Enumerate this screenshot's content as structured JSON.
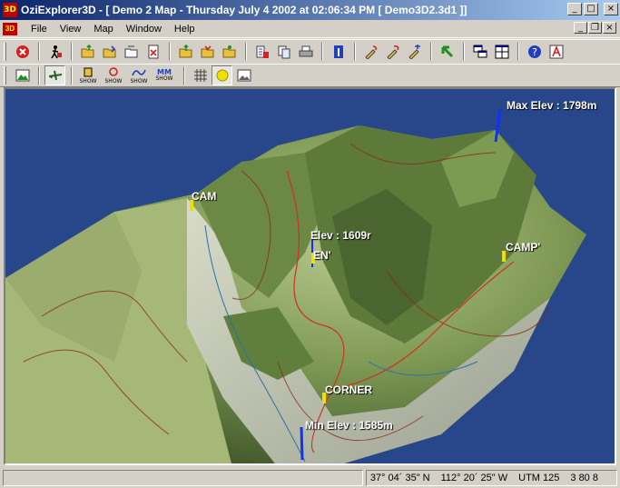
{
  "window": {
    "title": "OziExplorer3D - [ Demo 2 Map - Thursday July 4 2002  at  02:06:34 PM  [ Demo3D2.3d1 ]]",
    "app_icon_text": "3D"
  },
  "menu": {
    "items": [
      "File",
      "View",
      "Map",
      "Window",
      "Help"
    ]
  },
  "toolbar2": {
    "show_label": "SHOW",
    "mm_label": "MM"
  },
  "map": {
    "background_color": "#2a4a8a",
    "labels": {
      "max_elev": "Max Elev :  1798m",
      "min_elev": "Min Elev :  1585m",
      "elev": "Elev : 1609r",
      "cam": "CAM",
      "en": "EN'",
      "camp": "CAMP'",
      "corner": "CORNER"
    }
  },
  "status": {
    "main_text": "",
    "latitude": "37° 04´ 35\" N",
    "longitude": "112° 20´ 25\" W",
    "utm": "UTM  125",
    "easting": "3 80 8"
  }
}
